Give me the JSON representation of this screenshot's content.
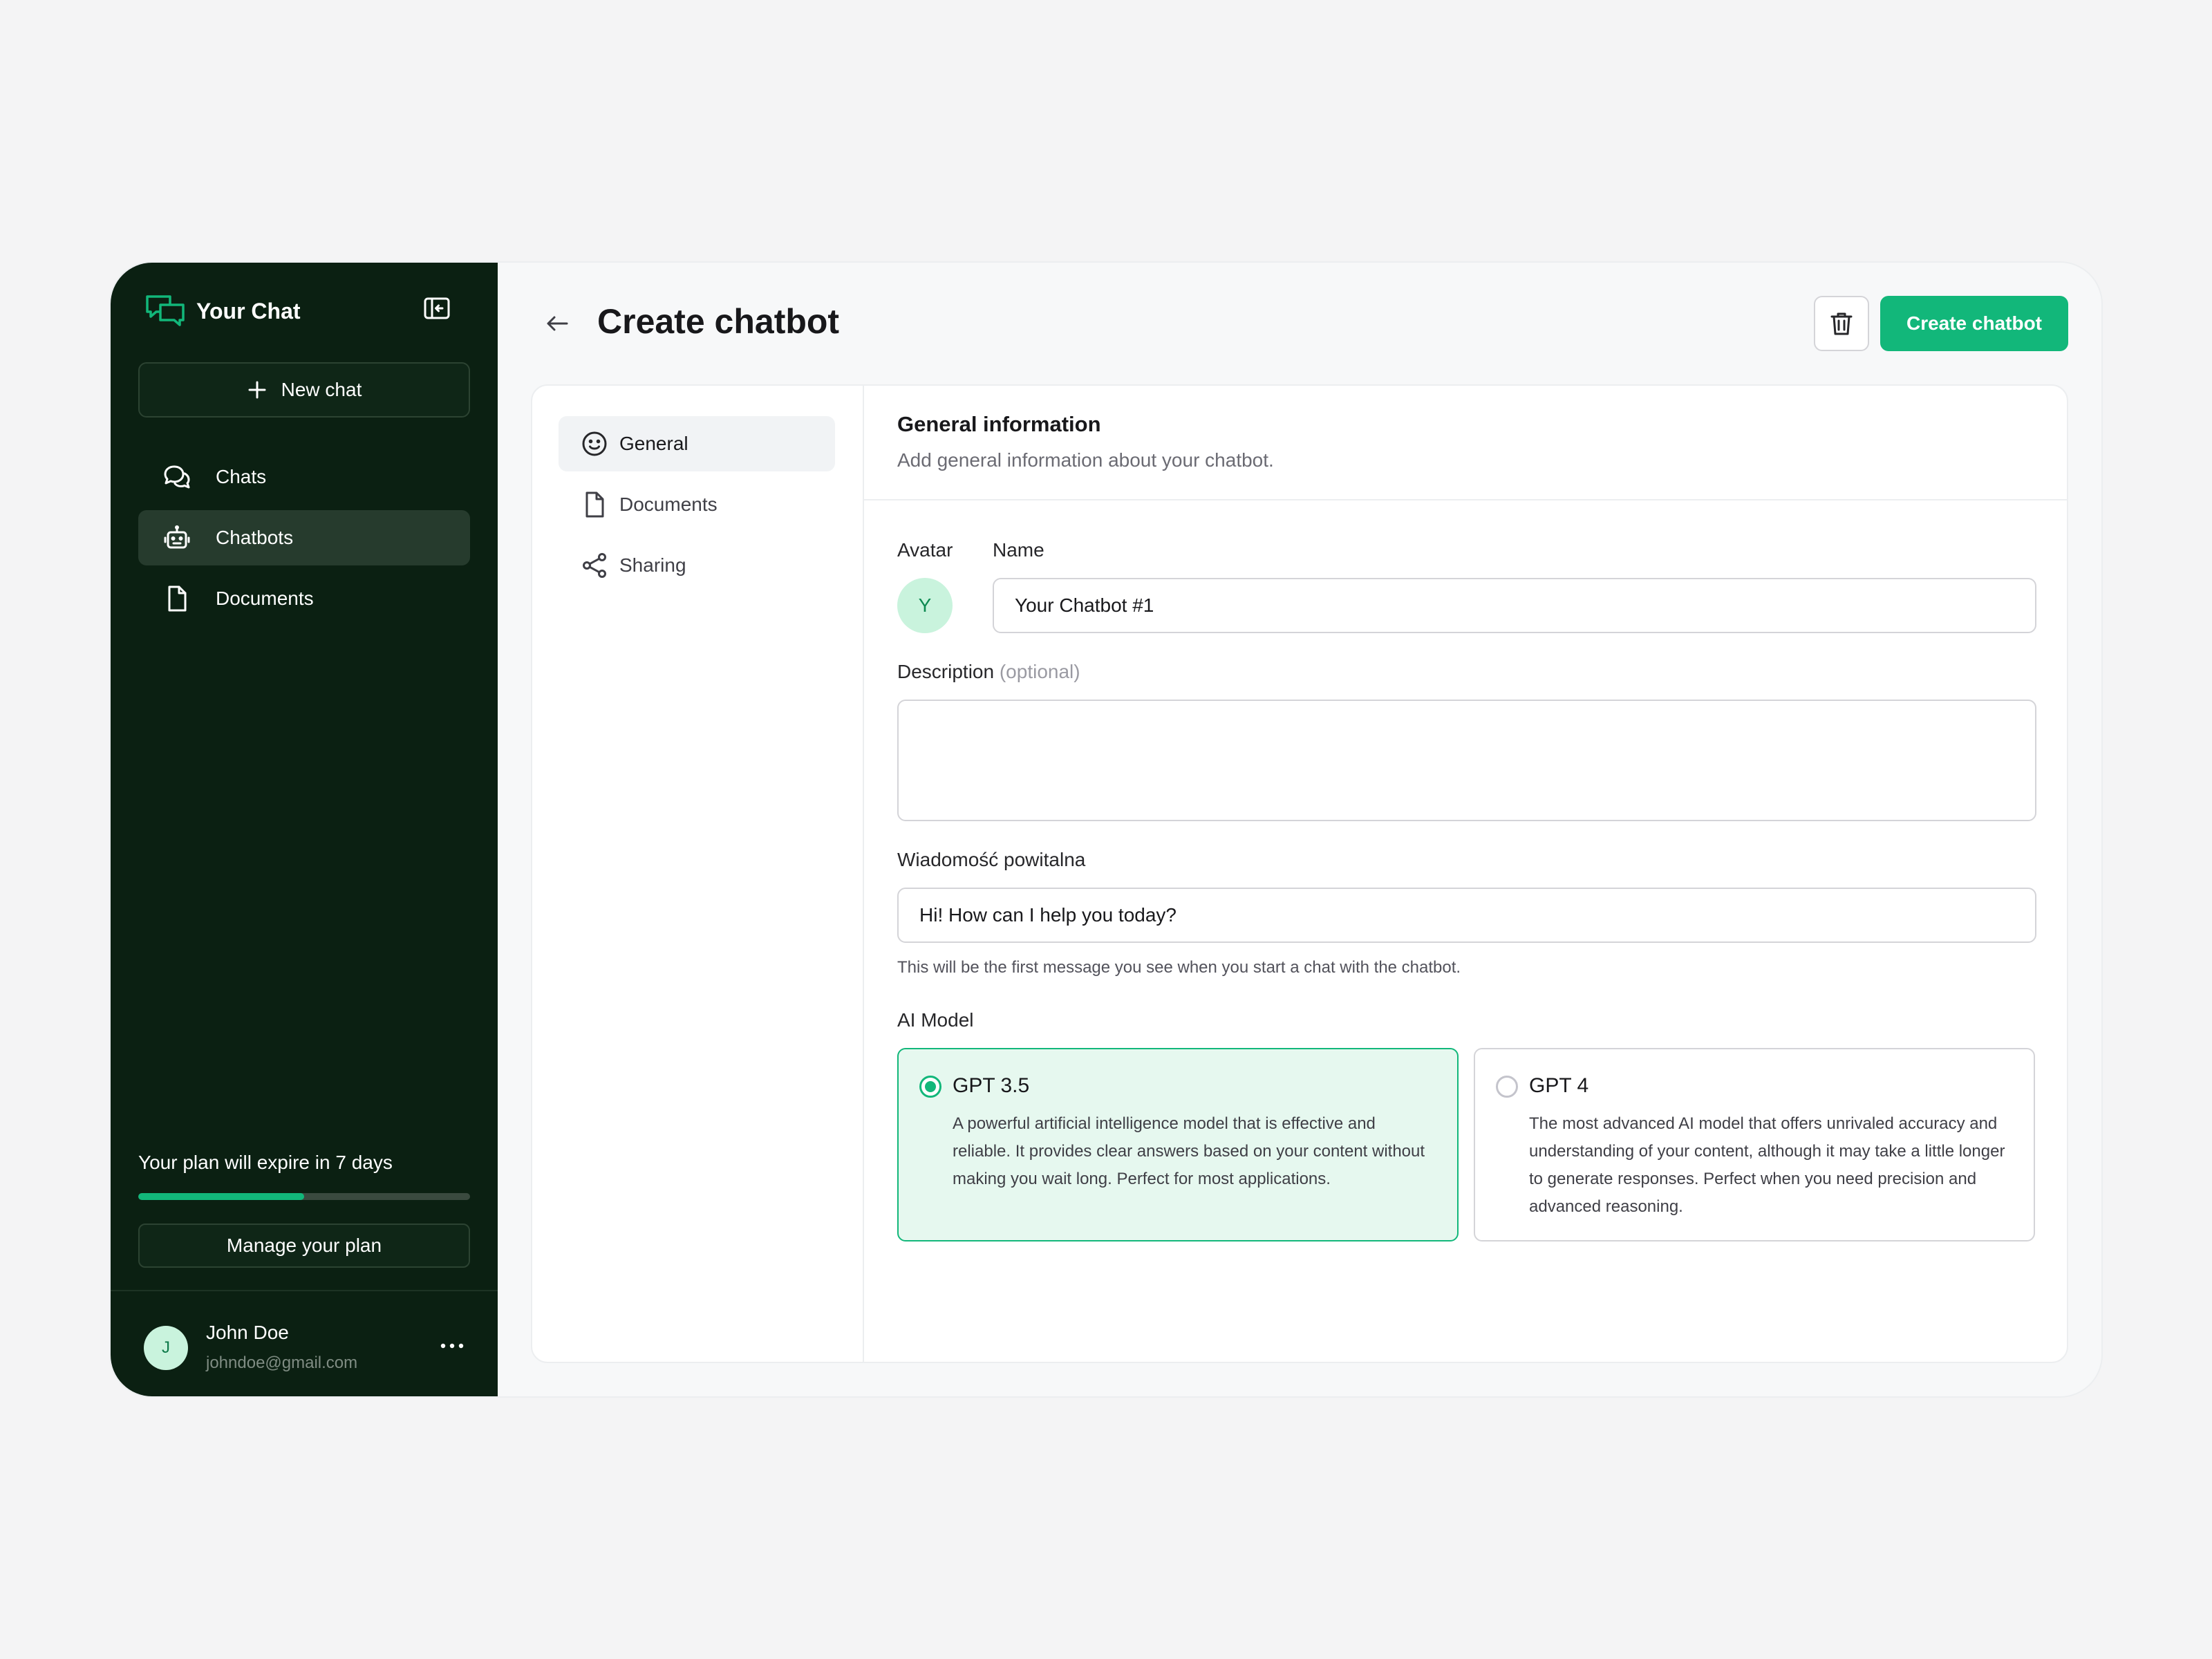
{
  "sidebar": {
    "brand": "Your Chat",
    "new_chat": "New chat",
    "items": [
      {
        "label": "Chats",
        "icon": "chats-icon"
      },
      {
        "label": "Chatbots",
        "icon": "robot-icon"
      },
      {
        "label": "Documents",
        "icon": "document-icon"
      }
    ],
    "plan_text": "Your plan will expire in 7 days",
    "plan_progress": 0.5,
    "manage_plan": "Manage your plan",
    "user": {
      "initial": "J",
      "name": "John Doe",
      "email": "johndoe@gmail.com"
    }
  },
  "header": {
    "title": "Create chatbot",
    "create_label": "Create chatbot"
  },
  "subnav": [
    {
      "label": "General",
      "icon": "smiley-icon"
    },
    {
      "label": "Documents",
      "icon": "document-icon"
    },
    {
      "label": "Sharing",
      "icon": "share-icon"
    }
  ],
  "form": {
    "section_title": "General information",
    "section_subtitle": "Add general information about your chatbot.",
    "avatar_label": "Avatar",
    "avatar_initial": "Y",
    "name_label": "Name",
    "name_value": "Your Chatbot #1",
    "description_label": "Description",
    "description_optional": "(optional)",
    "description_value": "",
    "welcome_label": "Wiadomość powitalna",
    "welcome_value": "Hi! How can I help you today?",
    "welcome_hint": "This will be the first message you see when you start a chat with the chatbot.",
    "model_label": "AI Model",
    "models": [
      {
        "name": "GPT 3.5",
        "selected": true,
        "description": "A powerful artificial intelligence model that is effective and reliable. It provides clear answers based on your content without making you wait long. Perfect for most applications."
      },
      {
        "name": "GPT 4",
        "selected": false,
        "description": "The most advanced AI model that offers unrivaled accuracy and understanding of your content, although it may take a little longer to generate responses. Perfect when you need precision and advanced reasoning."
      }
    ]
  },
  "colors": {
    "accent": "#12b77a",
    "sidebar_bg": "#0b2012",
    "selected_bg": "#e6f8ef"
  }
}
